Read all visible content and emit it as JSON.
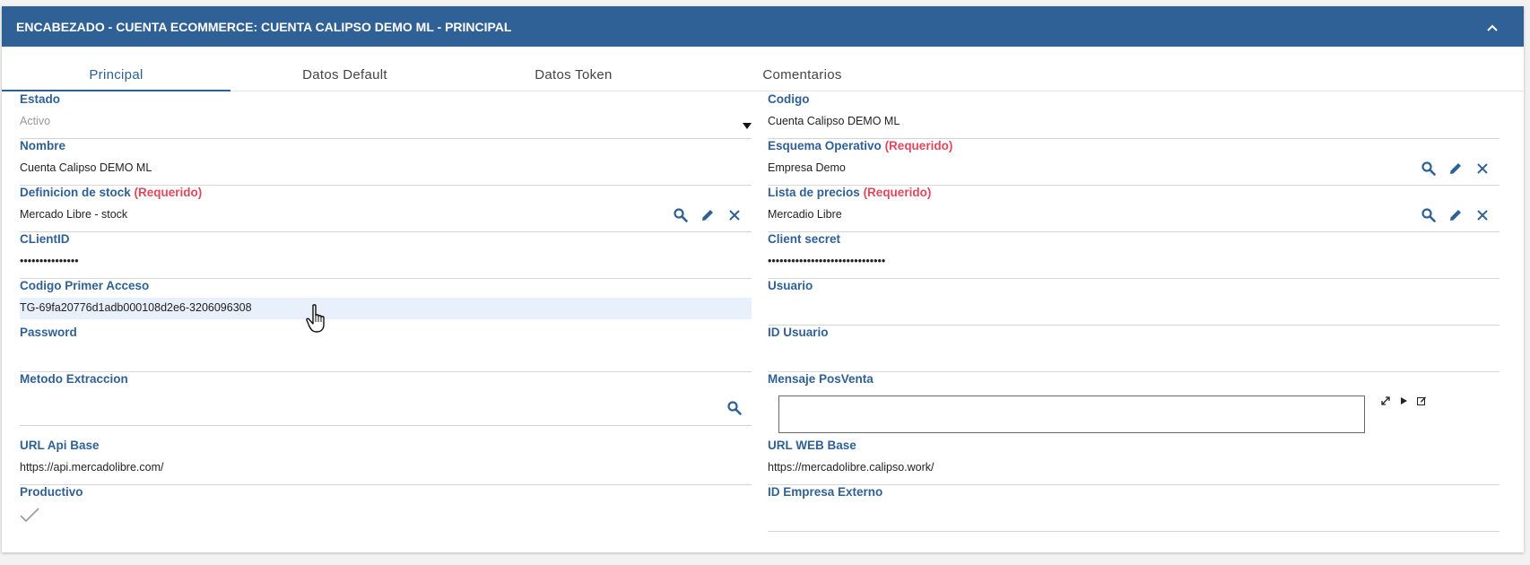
{
  "panel": {
    "title": "ENCABEZADO - CUENTA ECOMMERCE: CUENTA CALIPSO DEMO ML - PRINCIPAL"
  },
  "tabs": [
    {
      "label": "Principal",
      "active": true
    },
    {
      "label": "Datos Default",
      "active": false
    },
    {
      "label": "Datos Token",
      "active": false
    },
    {
      "label": "Comentarios",
      "active": false
    }
  ],
  "required_text": "(Requerido)",
  "left": {
    "estado": {
      "label": "Estado",
      "value": "Activo"
    },
    "nombre": {
      "label": "Nombre",
      "value": "Cuenta Calipso DEMO ML"
    },
    "definicion_stock": {
      "label": "Definicion de stock",
      "value": "Mercado Libre - stock"
    },
    "clientid": {
      "label": "CLientID",
      "value": "•••••••••••••••"
    },
    "codigo_primer_acceso": {
      "label": "Codigo Primer Acceso",
      "value": "TG-69fa20776d1adb000108d2e6-3206096308"
    },
    "password": {
      "label": "Password",
      "value": ""
    },
    "metodo_extraccion": {
      "label": "Metodo Extraccion",
      "value": ""
    },
    "url_api_base": {
      "label": "URL Api Base",
      "value": "https://api.mercadolibre.com/"
    },
    "productivo": {
      "label": "Productivo",
      "checked": true
    }
  },
  "right": {
    "codigo": {
      "label": "Codigo",
      "value": "Cuenta Calipso DEMO ML"
    },
    "esquema_operativo": {
      "label": "Esquema Operativo",
      "value": "Empresa Demo"
    },
    "lista_precios": {
      "label": "Lista de precios",
      "value": "Mercadio Libre"
    },
    "client_secret": {
      "label": "Client secret",
      "value": "••••••••••••••••••••••••••••••"
    },
    "usuario": {
      "label": "Usuario",
      "value": ""
    },
    "id_usuario": {
      "label": "ID Usuario",
      "value": ""
    },
    "mensaje_posventa": {
      "label": "Mensaje PosVenta",
      "value": ""
    },
    "url_web_base": {
      "label": "URL WEB Base",
      "value": "https://mercadolibre.calipso.work/"
    },
    "id_empresa_externo": {
      "label": "ID Empresa Externo",
      "value": ""
    }
  },
  "colors": {
    "header": "#2f6196",
    "label": "#2f6196",
    "required": "#e0485b",
    "highlight": "#e8f0fb"
  },
  "icons": [
    "chevron-up-icon",
    "search-icon",
    "pencil-icon",
    "close-icon",
    "expand-icon",
    "play-icon",
    "edit-note-icon",
    "checkmark-icon",
    "dropdown-arrow-icon",
    "hand-cursor-icon"
  ]
}
